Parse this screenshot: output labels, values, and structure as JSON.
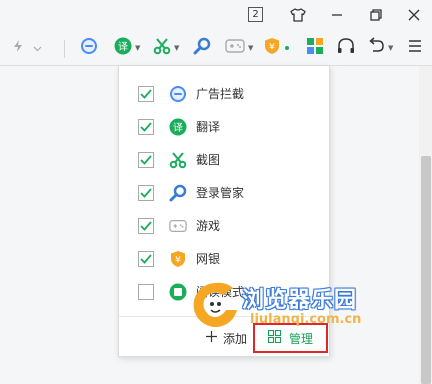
{
  "titlebar": {
    "tab_count": "2",
    "icons": [
      "tab-count-icon",
      "skin-icon",
      "minimize-icon",
      "restore-icon",
      "close-icon"
    ]
  },
  "toolbar": {
    "icons": [
      "lightning-icon",
      "dropdown-icon",
      "adblock-icon",
      "translate-icon",
      "screenshot-icon",
      "search-icon",
      "game-icon",
      "bank-icon",
      "apps-icon",
      "headphones-icon",
      "undo-icon",
      "menu-icon"
    ]
  },
  "panel": {
    "items": [
      {
        "label": "广告拦截",
        "checked": true,
        "icon": "adblock-icon",
        "color": "#4a8cf7"
      },
      {
        "label": "翻译",
        "checked": true,
        "icon": "translate-icon",
        "color": "#1aad5b"
      },
      {
        "label": "截图",
        "checked": true,
        "icon": "scissors-icon",
        "color": "#1aad5b"
      },
      {
        "label": "登录管家",
        "checked": true,
        "icon": "key-icon",
        "color": "#3a7bd5"
      },
      {
        "label": "游戏",
        "checked": true,
        "icon": "gamepad-icon",
        "color": "#999999"
      },
      {
        "label": "网银",
        "checked": true,
        "icon": "shield-yuan-icon",
        "color": "#f5a623"
      },
      {
        "label": "阅读模式",
        "checked": false,
        "icon": "reader-icon",
        "color": "#1aad5b"
      }
    ],
    "add_label": "添加",
    "manage_label": "管理"
  },
  "watermark": {
    "title": "浏览器乐园",
    "url": "liulanqi.com.cn"
  },
  "colors": {
    "check": "#1aad5b",
    "highlight_border": "#e1262b",
    "manage_text": "#18a058"
  }
}
